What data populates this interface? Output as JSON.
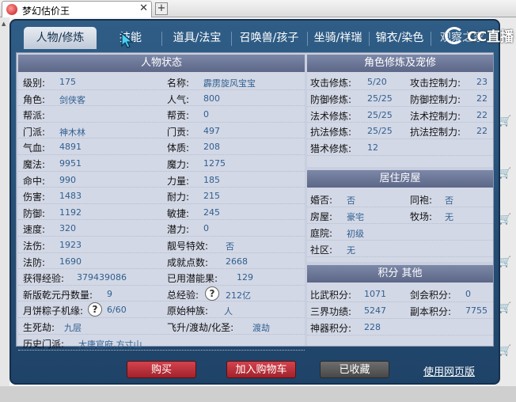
{
  "browser": {
    "tab_title": "梦幻估价王",
    "tab_close": "✕",
    "new_tab": "+"
  },
  "nav": {
    "tabs": [
      "人物/修炼",
      "技能",
      "道具/法宝",
      "召唤兽/孩子",
      "坐骑/祥瑞",
      "锦衣/染色",
      "观察之家"
    ],
    "watermark": "CC直播"
  },
  "left": {
    "title": "人物状态",
    "rows": [
      [
        {
          "l": "级别:",
          "v": "175"
        },
        {
          "l": "名称:",
          "v": "霹雳旋风宝宝"
        }
      ],
      [
        {
          "l": "角色:",
          "v": "剑侠客"
        },
        {
          "l": "人气:",
          "v": "800"
        }
      ],
      [
        {
          "l": "帮派:",
          "v": ""
        },
        {
          "l": "帮贡:",
          "v": "0"
        }
      ],
      [
        {
          "l": "门派:",
          "v": "神木林"
        },
        {
          "l": "门贡:",
          "v": "497"
        }
      ],
      [
        {
          "l": "气血:",
          "v": "4891"
        },
        {
          "l": "体质:",
          "v": "208"
        }
      ],
      [
        {
          "l": "魔法:",
          "v": "9951"
        },
        {
          "l": "魔力:",
          "v": "1275"
        }
      ],
      [
        {
          "l": "命中:",
          "v": "990"
        },
        {
          "l": "力量:",
          "v": "185"
        }
      ],
      [
        {
          "l": "伤害:",
          "v": "1483"
        },
        {
          "l": "耐力:",
          "v": "215"
        }
      ],
      [
        {
          "l": "防御:",
          "v": "1192"
        },
        {
          "l": "敏捷:",
          "v": "245"
        }
      ],
      [
        {
          "l": "速度:",
          "v": "320"
        },
        {
          "l": "潜力:",
          "v": "0"
        }
      ],
      [
        {
          "l": "法伤:",
          "v": "1923"
        },
        {
          "l": "靓号特效:",
          "v": "否"
        }
      ],
      [
        {
          "l": "法防:",
          "v": "1690"
        },
        {
          "l": "成就点数:",
          "v": "2668"
        }
      ],
      [
        {
          "l": "获得经验:",
          "v": "379439086"
        },
        {
          "l": "已用潜能果:",
          "v": "129"
        }
      ],
      [
        {
          "l": "新版乾元丹数量:",
          "v": "9"
        },
        {
          "l": "总经验:",
          "v": "212亿"
        }
      ],
      [
        {
          "l": "月饼粽子机缘:",
          "v": "6/60"
        },
        {
          "l": "原始种族:",
          "v": "人"
        }
      ],
      [
        {
          "l": "生死劫:",
          "v": "九层"
        },
        {
          "l": "飞升/渡劫/化圣:",
          "v": "渡劫"
        }
      ],
      [
        {
          "l": "历史门派:",
          "v": "大唐官府,方寸山"
        }
      ]
    ],
    "help_glyph": "?"
  },
  "right": {
    "cultivation": {
      "title": "角色修炼及宠修",
      "rows": [
        [
          {
            "l": "攻击修炼:",
            "v": "5/20"
          },
          {
            "l": "攻击控制力:",
            "v": "23"
          }
        ],
        [
          {
            "l": "防御修炼:",
            "v": "25/25"
          },
          {
            "l": "防御控制力:",
            "v": "22"
          }
        ],
        [
          {
            "l": "法术修炼:",
            "v": "25/25"
          },
          {
            "l": "法术控制力:",
            "v": "22"
          }
        ],
        [
          {
            "l": "抗法修炼:",
            "v": "25/25"
          },
          {
            "l": "抗法控制力:",
            "v": "22"
          }
        ],
        [
          {
            "l": "猎术修炼:",
            "v": "12"
          }
        ]
      ]
    },
    "house": {
      "title": "居住房屋",
      "rows": [
        [
          {
            "l": "婚否:",
            "v": "否"
          },
          {
            "l": "同袍:",
            "v": "否"
          }
        ],
        [
          {
            "l": "房屋:",
            "v": "豪宅"
          },
          {
            "l": "牧场:",
            "v": "无"
          }
        ],
        [
          {
            "l": "庭院:",
            "v": "初级"
          }
        ],
        [
          {
            "l": "社区:",
            "v": "无"
          }
        ]
      ]
    },
    "points": {
      "title": "积分 其他",
      "rows": [
        [
          {
            "l": "比武积分:",
            "v": "1071"
          },
          {
            "l": "剑会积分:",
            "v": "0"
          }
        ],
        [
          {
            "l": "三界功绩:",
            "v": "5247"
          },
          {
            "l": "副本积分:",
            "v": "7755"
          }
        ],
        [
          {
            "l": "神器积分:",
            "v": "228"
          }
        ]
      ]
    }
  },
  "actions": {
    "buy": "购买",
    "add_cart": "加入购物车",
    "collected": "已收藏",
    "web_version": "使用网页版"
  },
  "colors": {
    "panel": "#2f5d86",
    "value_text": "#2f5f8f",
    "buy_button": "#c0303a",
    "collected_button": "#5a5a5a"
  }
}
